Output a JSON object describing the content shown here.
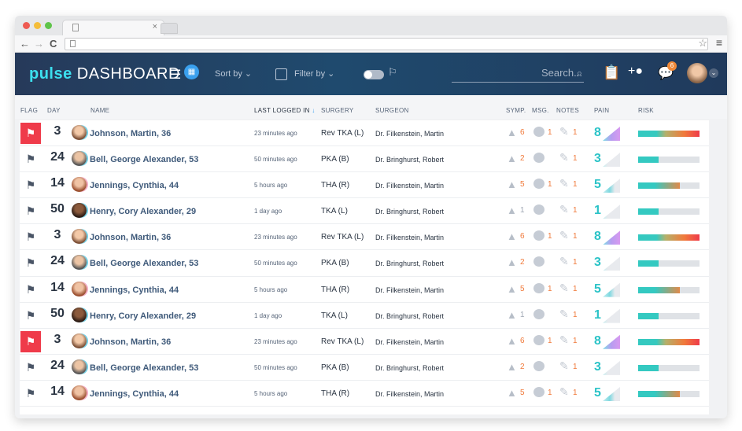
{
  "browser": {
    "tab_title": "",
    "tab_close": "×",
    "back": "←",
    "forward": "→",
    "reload": "C",
    "star": "☆",
    "menu": "≡"
  },
  "header": {
    "logo_bold": "pulse",
    "logo_rest": "DASHBOARD",
    "sort_label": "Sort by",
    "filter_label": "Filter by",
    "search_placeholder": "Search...",
    "notification_count": "6",
    "accent_color": "#3ce0ef"
  },
  "columns": {
    "flag": "FLAG",
    "day": "DAY",
    "name": "NAME",
    "last": "LAST LOGGED IN",
    "surgery": "SURGERY",
    "surgeon": "SURGEON",
    "symp": "SYMP.",
    "msg": "MSG.",
    "notes": "NOTES",
    "pain": "PAIN",
    "risk": "RISK"
  },
  "rows": [
    {
      "flag": true,
      "day": "3",
      "avatar": "a",
      "name": "Johnson, Martin, 36",
      "last": "23 minutes ago",
      "surgery": "Rev TKA (L)",
      "surgeon": "Dr. Filkenstein, Martin",
      "symp": "6",
      "msg": "1",
      "notes": "1",
      "pain": "8",
      "risk": 1.0
    },
    {
      "flag": false,
      "day": "24",
      "avatar": "b",
      "name": "Bell, George Alexander, 53",
      "last": "50 minutes ago",
      "surgery": "PKA (B)",
      "surgeon": "Dr. Bringhurst, Robert",
      "symp": "2",
      "msg": "",
      "notes": "1",
      "pain": "3",
      "risk": 0.33
    },
    {
      "flag": false,
      "day": "14",
      "avatar": "c",
      "name": "Jennings, Cynthia, 44",
      "last": "5 hours ago",
      "surgery": "THA (R)",
      "surgeon": "Dr. Filkenstein, Martin",
      "symp": "5",
      "msg": "1",
      "notes": "1",
      "pain": "5",
      "risk": 0.68
    },
    {
      "flag": false,
      "day": "50",
      "avatar": "d",
      "name": "Henry, Cory Alexander, 29",
      "last": "1 day ago",
      "surgery": "TKA (L)",
      "surgeon": "Dr. Bringhurst, Robert",
      "symp": "1",
      "msg": "",
      "notes": "1",
      "pain": "1",
      "risk": 0.33
    },
    {
      "flag": false,
      "day": "3",
      "avatar": "a",
      "name": "Johnson, Martin, 36",
      "last": "23 minutes ago",
      "surgery": "Rev TKA (L)",
      "surgeon": "Dr. Filkenstein, Martin",
      "symp": "6",
      "msg": "1",
      "notes": "1",
      "pain": "8",
      "risk": 1.0
    },
    {
      "flag": false,
      "day": "24",
      "avatar": "b",
      "name": "Bell, George Alexander, 53",
      "last": "50 minutes ago",
      "surgery": "PKA (B)",
      "surgeon": "Dr. Bringhurst, Robert",
      "symp": "2",
      "msg": "",
      "notes": "1",
      "pain": "3",
      "risk": 0.33
    },
    {
      "flag": false,
      "day": "14",
      "avatar": "c",
      "name": "Jennings, Cynthia, 44",
      "last": "5 hours ago",
      "surgery": "THA (R)",
      "surgeon": "Dr. Filkenstein, Martin",
      "symp": "5",
      "msg": "1",
      "notes": "1",
      "pain": "5",
      "risk": 0.68
    },
    {
      "flag": false,
      "day": "50",
      "avatar": "d",
      "name": "Henry, Cory Alexander, 29",
      "last": "1 day ago",
      "surgery": "TKA (L)",
      "surgeon": "Dr. Bringhurst, Robert",
      "symp": "1",
      "msg": "",
      "notes": "1",
      "pain": "1",
      "risk": 0.33
    },
    {
      "flag": true,
      "day": "3",
      "avatar": "a",
      "name": "Johnson, Martin, 36",
      "last": "23 minutes ago",
      "surgery": "Rev TKA (L)",
      "surgeon": "Dr. Filkenstein, Martin",
      "symp": "6",
      "msg": "1",
      "notes": "1",
      "pain": "8",
      "risk": 1.0
    },
    {
      "flag": false,
      "day": "24",
      "avatar": "b",
      "name": "Bell, George Alexander, 53",
      "last": "50 minutes ago",
      "surgery": "PKA (B)",
      "surgeon": "Dr. Bringhurst, Robert",
      "symp": "2",
      "msg": "",
      "notes": "1",
      "pain": "3",
      "risk": 0.33
    },
    {
      "flag": false,
      "day": "14",
      "avatar": "c",
      "name": "Jennings, Cynthia, 44",
      "last": "5 hours ago",
      "surgery": "THA (R)",
      "surgeon": "Dr. Filkenstein, Martin",
      "symp": "5",
      "msg": "1",
      "notes": "1",
      "pain": "5",
      "risk": 0.68
    }
  ]
}
